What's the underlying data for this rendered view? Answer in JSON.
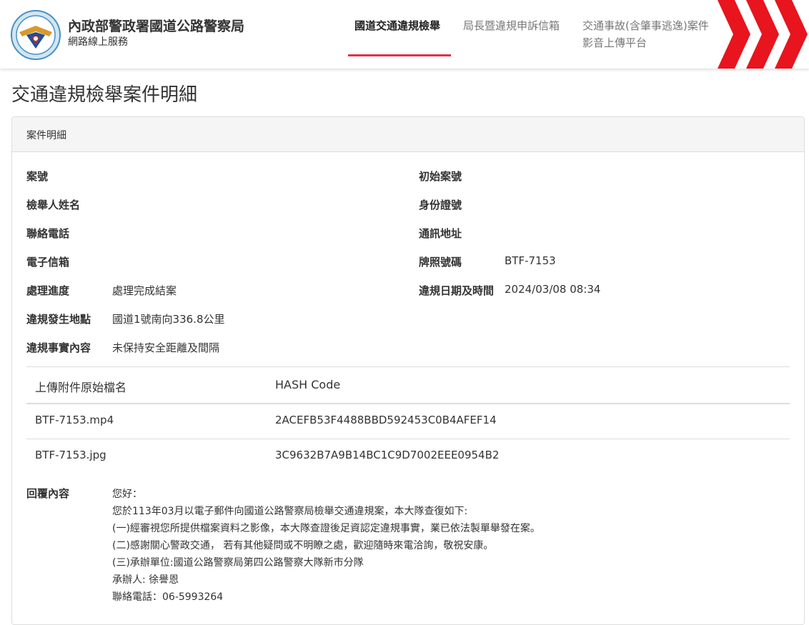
{
  "header": {
    "org_name": "內政部警政署國道公路警察局",
    "org_subtitle": "網路線上服務",
    "nav": [
      {
        "label": "國道交通違規檢舉",
        "active": true
      },
      {
        "label": "局長暨違規申訴信箱",
        "active": false
      },
      {
        "label_line1": "交通事故(含肇事逃逸)案件",
        "label_line2": "影音上傳平台",
        "active": false
      }
    ],
    "accent_color": "#e0314b",
    "brand_red": "#e8141e"
  },
  "page": {
    "title": "交通違規檢舉案件明細"
  },
  "panel": {
    "heading": "案件明細",
    "left_fields": [
      {
        "label": "案號",
        "value": ""
      },
      {
        "label": "檢舉人姓名",
        "value": ""
      },
      {
        "label": "聯絡電話",
        "value": ""
      },
      {
        "label": "電子信箱",
        "value": ""
      },
      {
        "label": "處理進度",
        "value": "處理完成結案"
      },
      {
        "label": "違規發生地點",
        "value": "國道1號南向336.8公里"
      },
      {
        "label": "違規事實內容",
        "value": "未保持安全距離及間隔"
      }
    ],
    "right_fields": [
      {
        "label": "初始案號",
        "value": ""
      },
      {
        "label": "身份證號",
        "value": ""
      },
      {
        "label": "通訊地址",
        "value": ""
      },
      {
        "label": "牌照號碼",
        "value": "BTF-7153"
      },
      {
        "label": "違規日期及時間",
        "value": "2024/03/08 08:34"
      }
    ],
    "attachments": {
      "headers": [
        "上傳附件原始檔名",
        "HASH Code"
      ],
      "rows": [
        {
          "filename": "BTF-7153.mp4",
          "hash": "2ACEFB53F4488BBD592453C0B4AFEF14"
        },
        {
          "filename": "BTF-7153.jpg",
          "hash": "3C9632B7A9B14BC1C9D7002EEE0954B2"
        }
      ]
    },
    "reply": {
      "label": "回覆內容",
      "lines": [
        "您好：",
        "您於113年03月以電子郵件向國道公路警察局檢舉交通違規案，本大隊查復如下:",
        "(一)經審視您所提供檔案資料之影像，本大隊查證後足資認定違規事實，業已依法製單舉發在案。",
        "(二)感謝關心警政交通， 若有其他疑問或不明瞭之處，歡迎隨時來電洽詢，敬祝安康。",
        "(三)承辦單位:國道公路警察局第四公路警察大隊新市分隊",
        "承辦人: 徐譽恩",
        "聯絡電話：06-5993264"
      ]
    }
  }
}
